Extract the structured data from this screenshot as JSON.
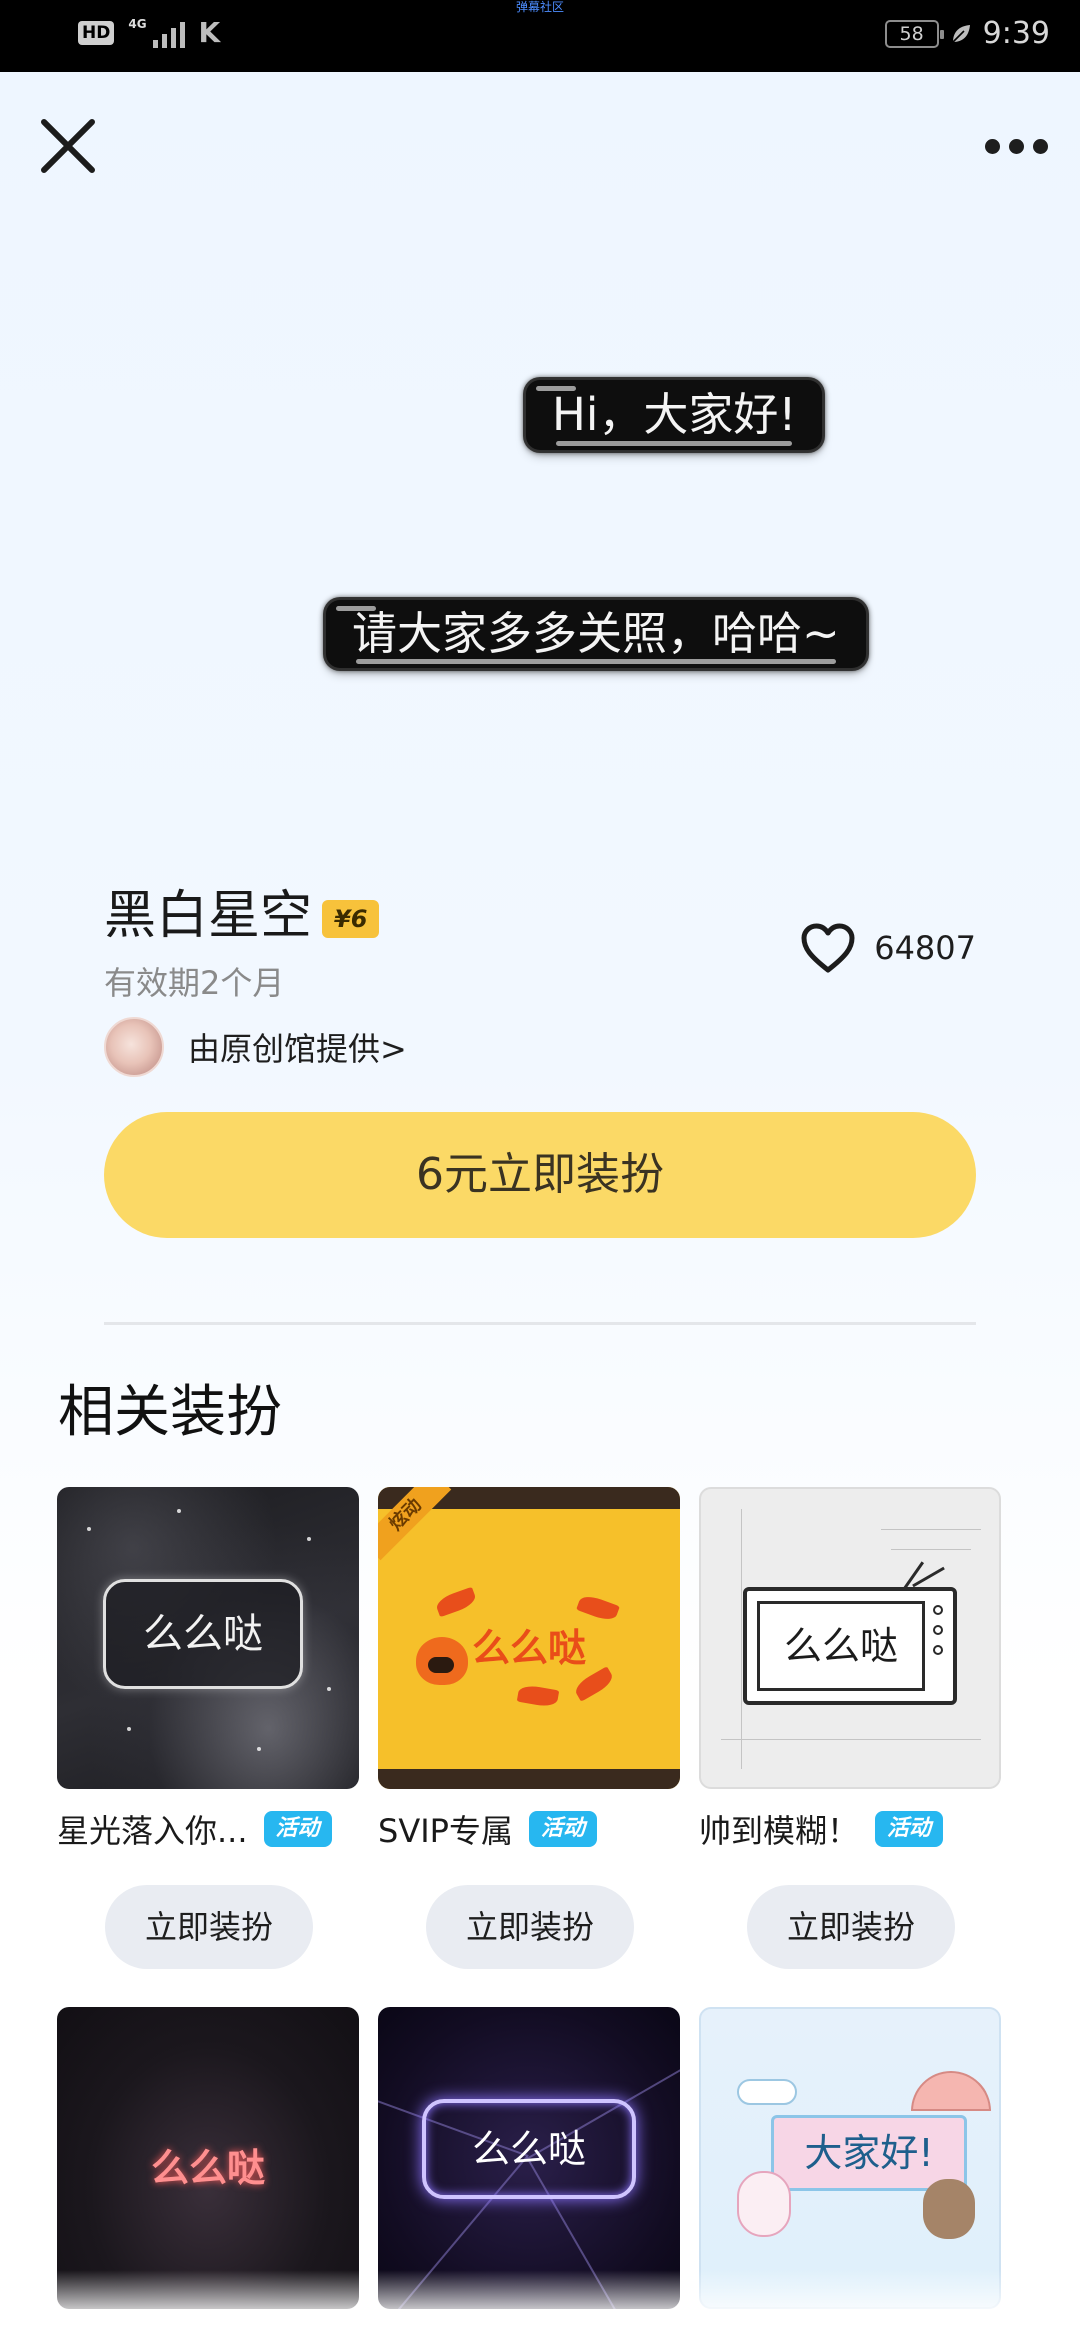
{
  "status_bar": {
    "network_badge": "HD",
    "network_type": "4G",
    "carrier_label": "弹幕社区",
    "battery": "58",
    "time": "9:39"
  },
  "header": {
    "close_icon": "close-icon",
    "more_icon": "more-icon"
  },
  "preview": {
    "bubble_1": "Hi，大家好!",
    "bubble_2": "请大家多多关照，哈哈~"
  },
  "product": {
    "name": "黑白星空",
    "price_badge": "¥6",
    "validity": "有效期2个月",
    "provider": "由原创馆提供>",
    "like_count": "64807"
  },
  "main_button": "6元立即装扮",
  "related": {
    "title": "相关装扮",
    "items": [
      {
        "thumb_text": "么么哒",
        "title": "星光落入你...",
        "tag": "活动",
        "button": "立即装扮"
      },
      {
        "thumb_text": "么么哒",
        "corner_badge": "炫动",
        "title": "SVIP专属",
        "tag": "活动",
        "button": "立即装扮"
      },
      {
        "thumb_text": "么么哒",
        "title": "帅到模糊！",
        "tag": "活动",
        "button": "立即装扮"
      },
      {
        "thumb_text": "么么哒"
      },
      {
        "thumb_text": "么么哒"
      },
      {
        "thumb_text": "大家好!"
      }
    ]
  },
  "colors": {
    "accent_button": "#fbd966",
    "price_badge": "#f7c23b",
    "activity_tag": "#27b7f0",
    "secondary_button": "#e9ecf2"
  }
}
